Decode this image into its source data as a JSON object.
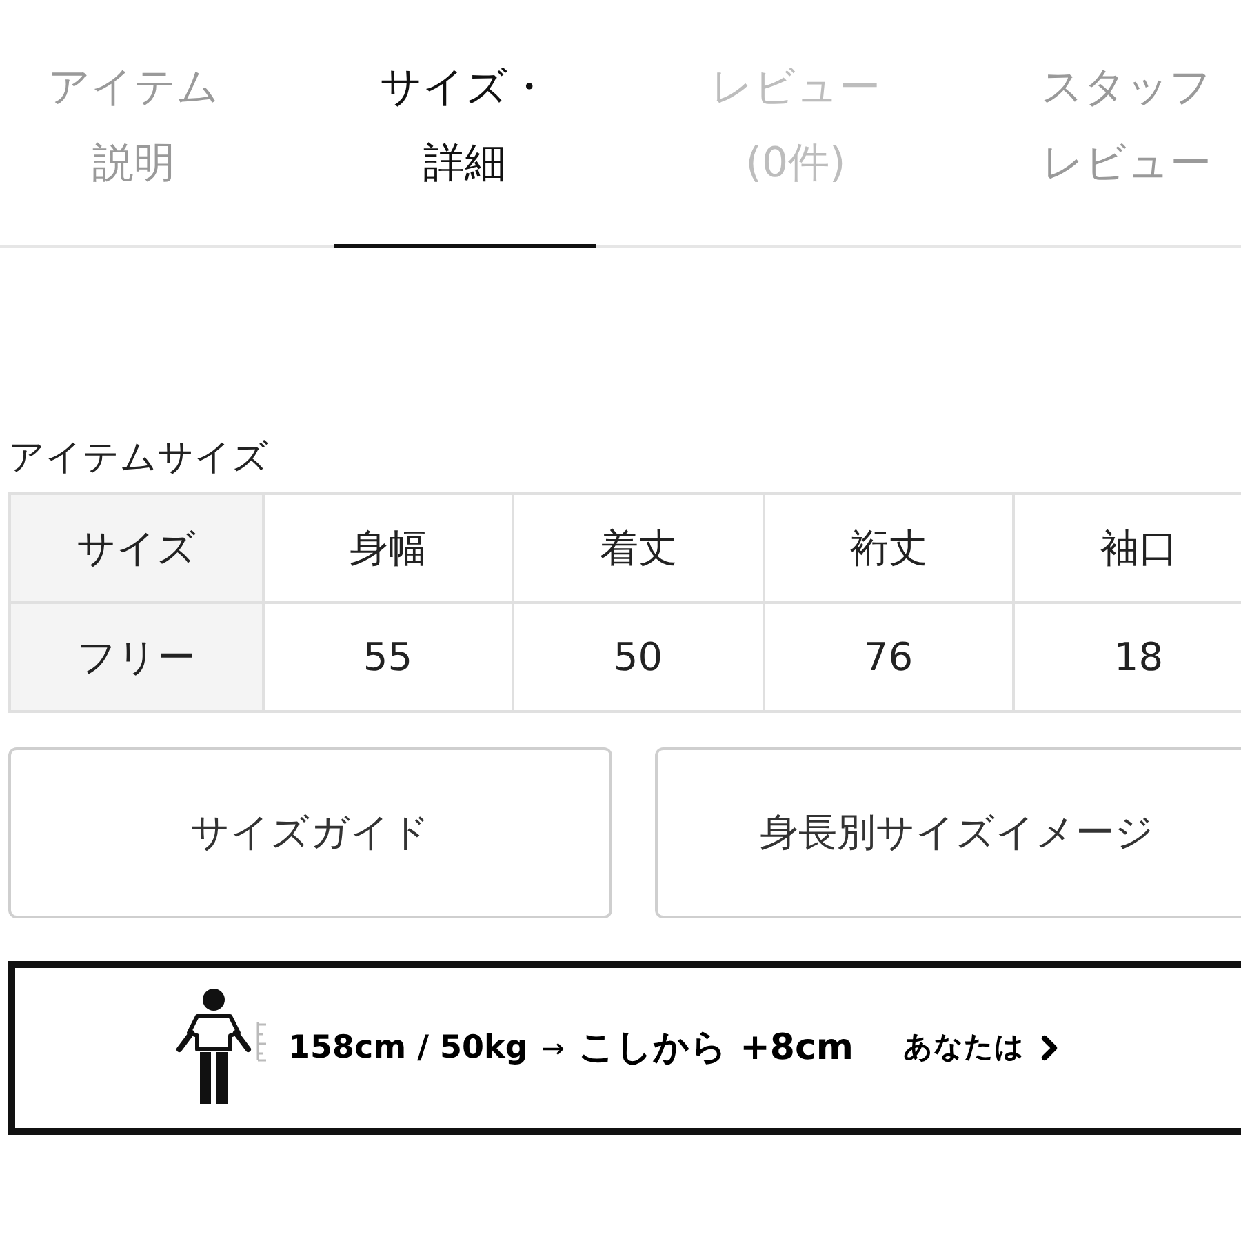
{
  "tabs": [
    {
      "lines": [
        "アイテム",
        "説明"
      ],
      "selected": false,
      "disabled": false
    },
    {
      "lines": [
        "サイズ・",
        "詳細"
      ],
      "selected": true,
      "disabled": false
    },
    {
      "lines": [
        "レビュー",
        "(0件)"
      ],
      "selected": false,
      "disabled": true
    },
    {
      "lines": [
        "スタッフ",
        "レビュー"
      ],
      "selected": false,
      "disabled": false
    }
  ],
  "size_table": {
    "title": "アイテムサイズ",
    "columns": [
      "サイズ",
      "身幅",
      "着丈",
      "裄丈",
      "袖口"
    ],
    "rows": [
      [
        "フリー",
        "55",
        "50",
        "76",
        "18"
      ]
    ]
  },
  "buttons": [
    "サイズガイド",
    "身長別サイズイメージ"
  ],
  "recommendation": {
    "measurements": "158cm / 50kg",
    "arrow": "→",
    "fit": "こしから +8cm",
    "link": "あなたは"
  }
}
